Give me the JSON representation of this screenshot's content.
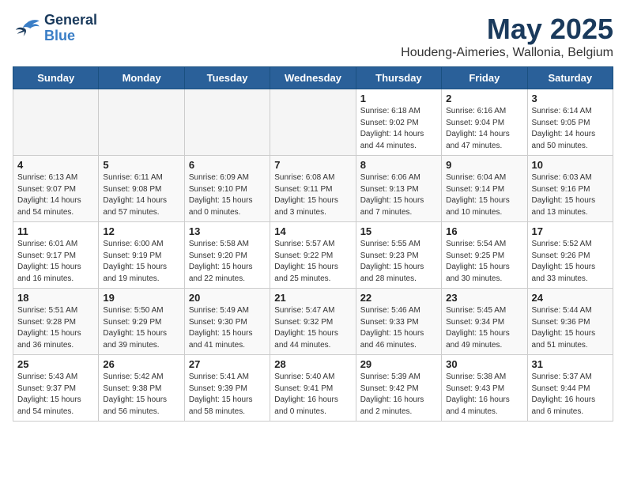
{
  "header": {
    "logo_general": "General",
    "logo_blue": "Blue",
    "month_year": "May 2025",
    "location": "Houdeng-Aimeries, Wallonia, Belgium"
  },
  "days_of_week": [
    "Sunday",
    "Monday",
    "Tuesday",
    "Wednesday",
    "Thursday",
    "Friday",
    "Saturday"
  ],
  "weeks": [
    [
      {
        "day": "",
        "empty": true
      },
      {
        "day": "",
        "empty": true
      },
      {
        "day": "",
        "empty": true
      },
      {
        "day": "",
        "empty": true
      },
      {
        "day": "1",
        "sunrise": "6:18 AM",
        "sunset": "9:02 PM",
        "daylight": "14 hours and 44 minutes."
      },
      {
        "day": "2",
        "sunrise": "6:16 AM",
        "sunset": "9:04 PM",
        "daylight": "14 hours and 47 minutes."
      },
      {
        "day": "3",
        "sunrise": "6:14 AM",
        "sunset": "9:05 PM",
        "daylight": "14 hours and 50 minutes."
      }
    ],
    [
      {
        "day": "4",
        "sunrise": "6:13 AM",
        "sunset": "9:07 PM",
        "daylight": "14 hours and 54 minutes."
      },
      {
        "day": "5",
        "sunrise": "6:11 AM",
        "sunset": "9:08 PM",
        "daylight": "14 hours and 57 minutes."
      },
      {
        "day": "6",
        "sunrise": "6:09 AM",
        "sunset": "9:10 PM",
        "daylight": "15 hours and 0 minutes."
      },
      {
        "day": "7",
        "sunrise": "6:08 AM",
        "sunset": "9:11 PM",
        "daylight": "15 hours and 3 minutes."
      },
      {
        "day": "8",
        "sunrise": "6:06 AM",
        "sunset": "9:13 PM",
        "daylight": "15 hours and 7 minutes."
      },
      {
        "day": "9",
        "sunrise": "6:04 AM",
        "sunset": "9:14 PM",
        "daylight": "15 hours and 10 minutes."
      },
      {
        "day": "10",
        "sunrise": "6:03 AM",
        "sunset": "9:16 PM",
        "daylight": "15 hours and 13 minutes."
      }
    ],
    [
      {
        "day": "11",
        "sunrise": "6:01 AM",
        "sunset": "9:17 PM",
        "daylight": "15 hours and 16 minutes."
      },
      {
        "day": "12",
        "sunrise": "6:00 AM",
        "sunset": "9:19 PM",
        "daylight": "15 hours and 19 minutes."
      },
      {
        "day": "13",
        "sunrise": "5:58 AM",
        "sunset": "9:20 PM",
        "daylight": "15 hours and 22 minutes."
      },
      {
        "day": "14",
        "sunrise": "5:57 AM",
        "sunset": "9:22 PM",
        "daylight": "15 hours and 25 minutes."
      },
      {
        "day": "15",
        "sunrise": "5:55 AM",
        "sunset": "9:23 PM",
        "daylight": "15 hours and 28 minutes."
      },
      {
        "day": "16",
        "sunrise": "5:54 AM",
        "sunset": "9:25 PM",
        "daylight": "15 hours and 30 minutes."
      },
      {
        "day": "17",
        "sunrise": "5:52 AM",
        "sunset": "9:26 PM",
        "daylight": "15 hours and 33 minutes."
      }
    ],
    [
      {
        "day": "18",
        "sunrise": "5:51 AM",
        "sunset": "9:28 PM",
        "daylight": "15 hours and 36 minutes."
      },
      {
        "day": "19",
        "sunrise": "5:50 AM",
        "sunset": "9:29 PM",
        "daylight": "15 hours and 39 minutes."
      },
      {
        "day": "20",
        "sunrise": "5:49 AM",
        "sunset": "9:30 PM",
        "daylight": "15 hours and 41 minutes."
      },
      {
        "day": "21",
        "sunrise": "5:47 AM",
        "sunset": "9:32 PM",
        "daylight": "15 hours and 44 minutes."
      },
      {
        "day": "22",
        "sunrise": "5:46 AM",
        "sunset": "9:33 PM",
        "daylight": "15 hours and 46 minutes."
      },
      {
        "day": "23",
        "sunrise": "5:45 AM",
        "sunset": "9:34 PM",
        "daylight": "15 hours and 49 minutes."
      },
      {
        "day": "24",
        "sunrise": "5:44 AM",
        "sunset": "9:36 PM",
        "daylight": "15 hours and 51 minutes."
      }
    ],
    [
      {
        "day": "25",
        "sunrise": "5:43 AM",
        "sunset": "9:37 PM",
        "daylight": "15 hours and 54 minutes."
      },
      {
        "day": "26",
        "sunrise": "5:42 AM",
        "sunset": "9:38 PM",
        "daylight": "15 hours and 56 minutes."
      },
      {
        "day": "27",
        "sunrise": "5:41 AM",
        "sunset": "9:39 PM",
        "daylight": "15 hours and 58 minutes."
      },
      {
        "day": "28",
        "sunrise": "5:40 AM",
        "sunset": "9:41 PM",
        "daylight": "16 hours and 0 minutes."
      },
      {
        "day": "29",
        "sunrise": "5:39 AM",
        "sunset": "9:42 PM",
        "daylight": "16 hours and 2 minutes."
      },
      {
        "day": "30",
        "sunrise": "5:38 AM",
        "sunset": "9:43 PM",
        "daylight": "16 hours and 4 minutes."
      },
      {
        "day": "31",
        "sunrise": "5:37 AM",
        "sunset": "9:44 PM",
        "daylight": "16 hours and 6 minutes."
      }
    ]
  ]
}
